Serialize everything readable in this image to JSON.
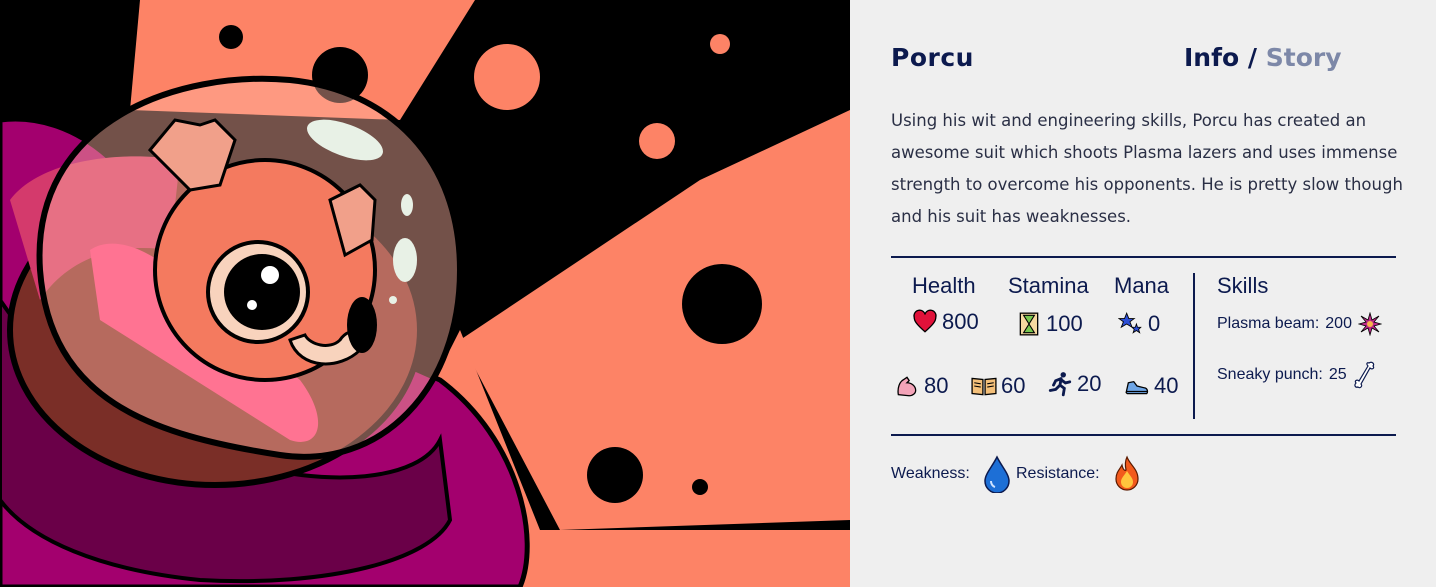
{
  "character": {
    "name": "Porcu",
    "description": "Using his wit and engineering skills, Porcu has created an awesome suit which shoots Plasma lazers and uses immense strength to overcome his opponents. He is pretty slow though and his suit has weaknesses."
  },
  "tabs": {
    "info": "Info",
    "separator": "/",
    "story": "Story",
    "active": "Info"
  },
  "stats": {
    "headers": {
      "health": "Health",
      "stamina": "Stamina",
      "mana": "Mana"
    },
    "health": "800",
    "stamina": "100",
    "mana": "0",
    "strength": "80",
    "intelligence": "60",
    "agility": "20",
    "speed": "40"
  },
  "skills": {
    "title": "Skills",
    "items": [
      {
        "label": "Plasma beam:",
        "value": "200",
        "icon": "plasma-burst-icon"
      },
      {
        "label": "Sneaky punch:",
        "value": "25",
        "icon": "bone-icon"
      }
    ]
  },
  "affinities": {
    "weakness_label": "Weakness:",
    "weakness_icon": "water-drop-icon",
    "resistance_label": "Resistance:",
    "resistance_icon": "fire-icon"
  },
  "colors": {
    "navy": "#0c1a4e",
    "story_tab": "#7d88a8",
    "salmon": "#fd8366",
    "magenta": "#a3006e",
    "panel_bg": "#efefef"
  }
}
